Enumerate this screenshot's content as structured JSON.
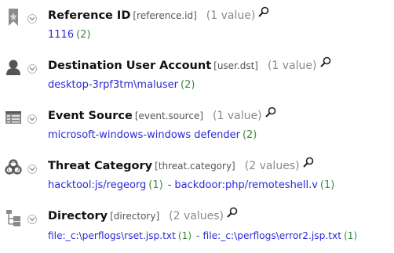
{
  "fields": [
    {
      "icon": "bookmark-icon",
      "title": "Reference ID",
      "key": "[reference.id]",
      "count": "(1 value)",
      "values": [
        {
          "text": "1116",
          "count": "(2)"
        }
      ]
    },
    {
      "icon": "user-icon",
      "title": "Destination User Account",
      "key": "[user.dst]",
      "count": "(1 value)",
      "values": [
        {
          "text": "desktop-3rpf3tm\\maluser",
          "count": "(2)"
        }
      ]
    },
    {
      "icon": "event-log-icon",
      "title": "Event Source",
      "key": "[event.source]",
      "count": "(1 value)",
      "values": [
        {
          "text": "microsoft-windows-windows defender",
          "count": "(2)"
        }
      ]
    },
    {
      "icon": "biohazard-icon",
      "title": "Threat Category",
      "key": "[threat.category]",
      "count": "(2 values)",
      "values": [
        {
          "text": "hacktool:js/regeorg",
          "count": "(1)"
        },
        {
          "text": "backdoor:php/remoteshell.v",
          "count": "(1)"
        }
      ]
    },
    {
      "icon": "directory-tree-icon",
      "title": "Directory",
      "key": "[directory]",
      "count": "(2 values)",
      "values": [
        {
          "text": "file:_c:\\perflogs\\rset.jsp.txt",
          "count": "(1)"
        },
        {
          "text": "file:_c:\\perflogs\\error2.jsp.txt",
          "count": "(1)"
        }
      ]
    }
  ],
  "separator": "-"
}
